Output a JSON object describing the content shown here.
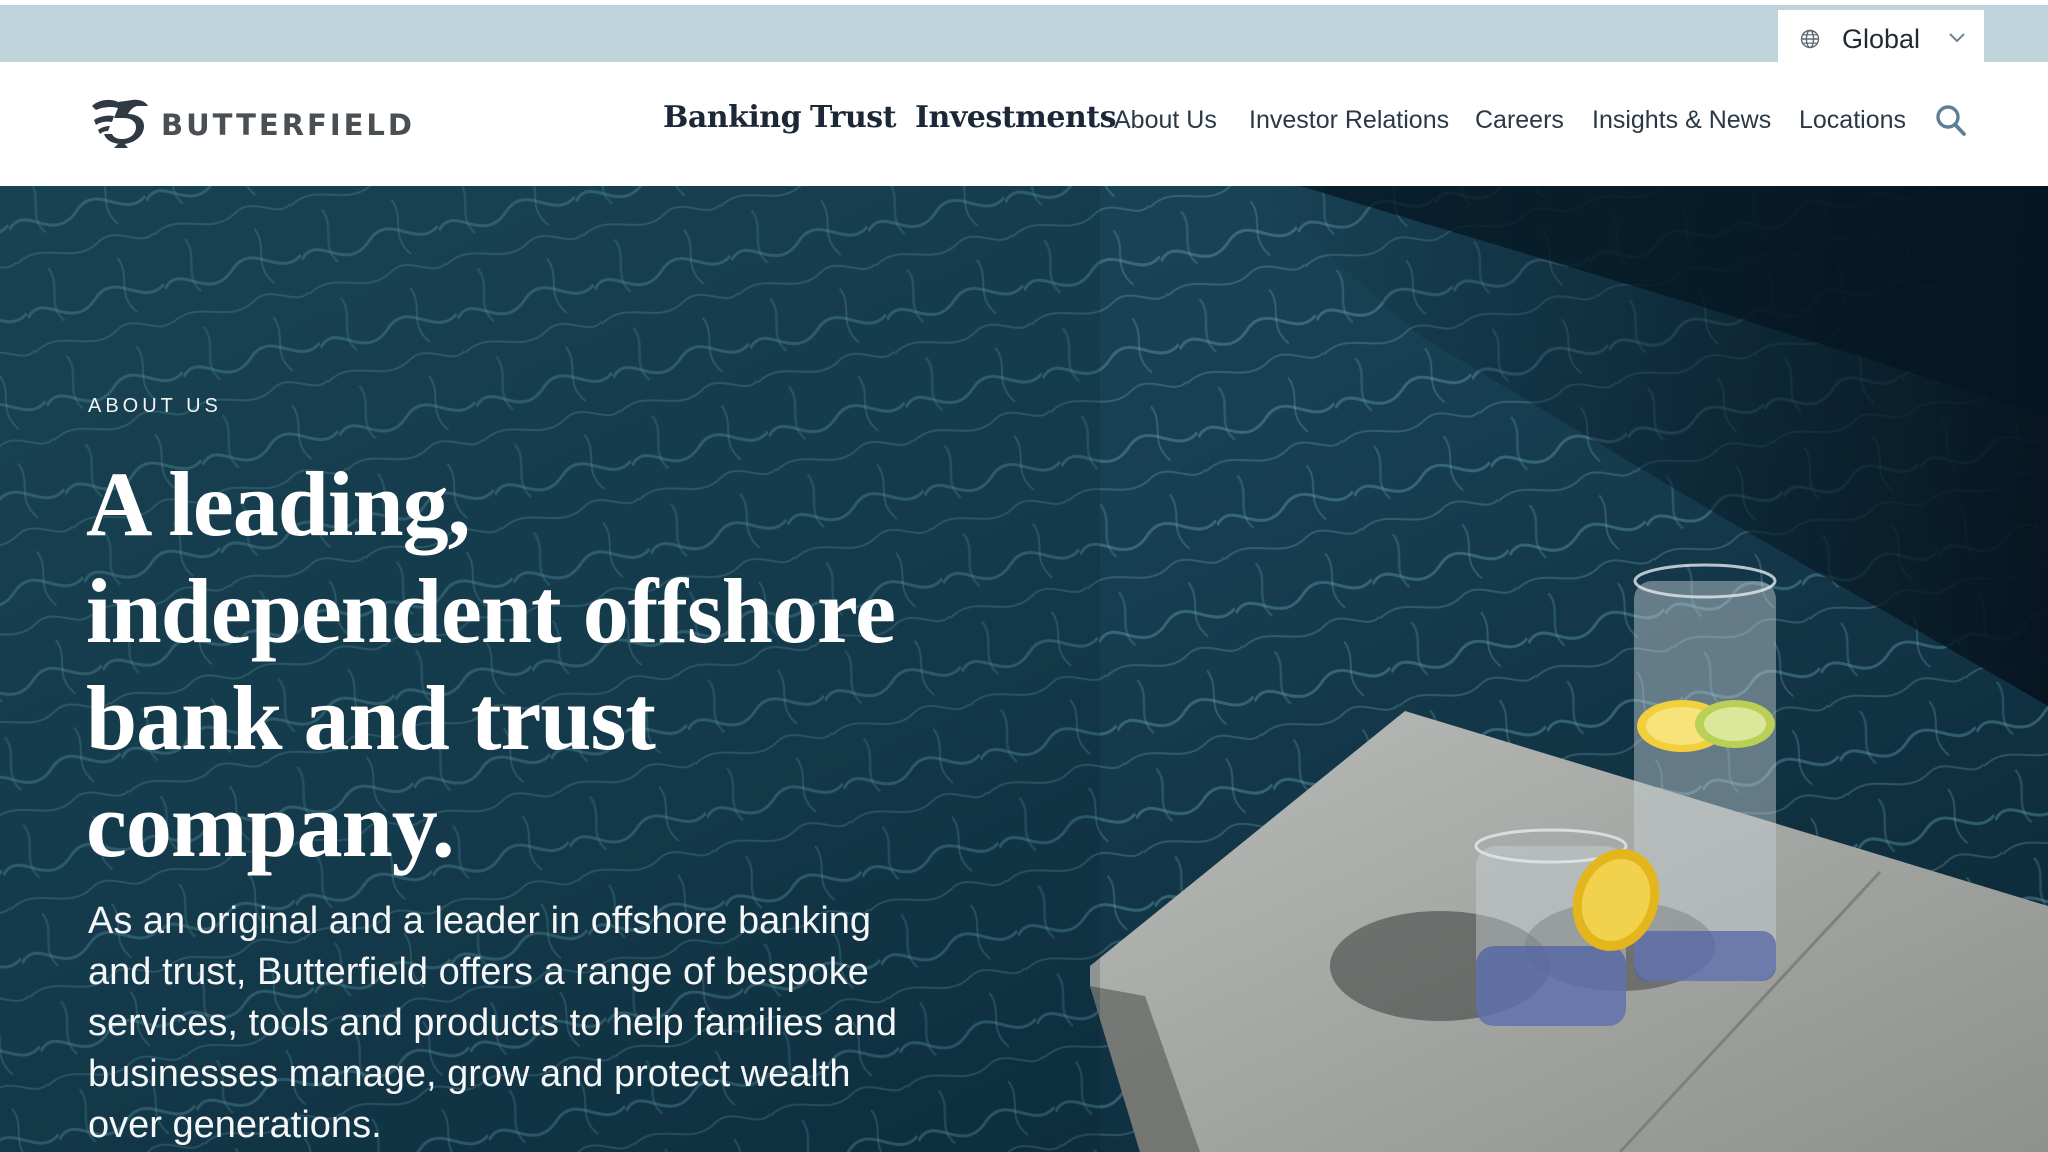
{
  "utility": {
    "region_label": "Global",
    "globe_icon": "globe-icon",
    "chevron_icon": "chevron-down-icon"
  },
  "brand": {
    "name": "BUTTERFIELD",
    "logo_icon": "griffin-logo-icon"
  },
  "nav": {
    "primary": [
      "Banking",
      "Trust",
      "Investments"
    ],
    "secondary": [
      "About Us",
      "Investor Relations",
      "Careers",
      "Insights & News",
      "Locations"
    ],
    "search_icon": "search-icon"
  },
  "hero": {
    "eyebrow": "ABOUT US",
    "headline": "A leading, independent offshore bank and trust company.",
    "body": "As an original and a leader in offshore banking and trust, Butterfield offers a range of bespoke services, tools and products to help families and businesses manage, grow and protect wealth over generations."
  },
  "colors": {
    "utility_bar": "#bfd3da",
    "nav_text": "#1c2838",
    "accent": "#5d7f93",
    "hero_water": "#0e2a38"
  }
}
